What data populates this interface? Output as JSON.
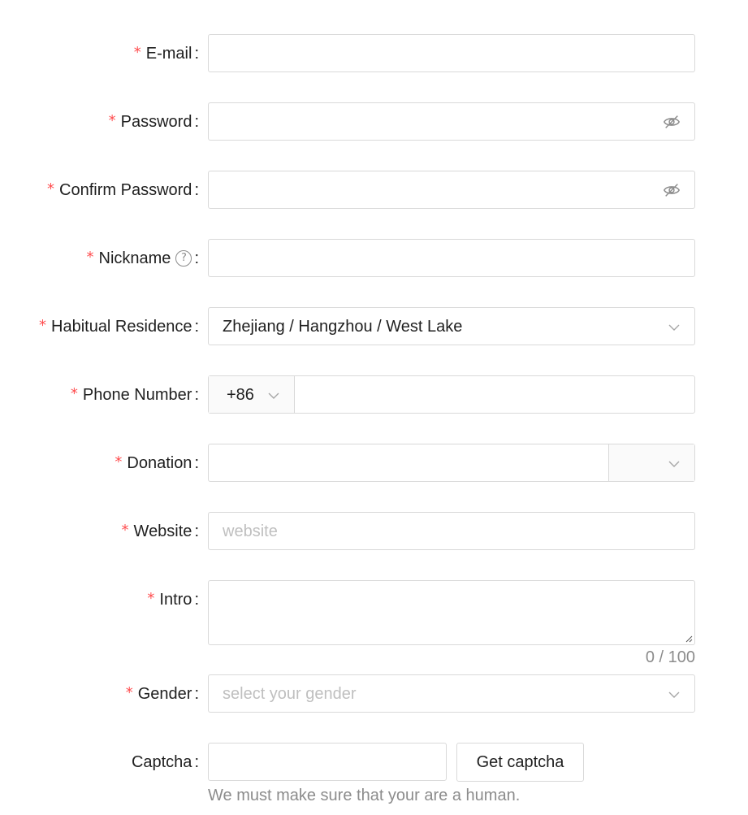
{
  "form": {
    "email": {
      "label": "E-mail",
      "value": ""
    },
    "password": {
      "label": "Password",
      "value": "",
      "visibility_icon": "eye-invisible-icon"
    },
    "confirm_password": {
      "label": "Confirm Password",
      "value": "",
      "visibility_icon": "eye-invisible-icon"
    },
    "nickname": {
      "label": "Nickname",
      "help_icon": "question-circle-icon",
      "help_glyph": "?",
      "value": ""
    },
    "residence": {
      "label": "Habitual Residence",
      "value": "Zhejiang / Hangzhou / West Lake"
    },
    "phone": {
      "label": "Phone Number",
      "prefix": "+86",
      "value": ""
    },
    "donation": {
      "label": "Donation",
      "value": "",
      "suffix": ""
    },
    "website": {
      "label": "Website",
      "placeholder": "website",
      "value": ""
    },
    "intro": {
      "label": "Intro",
      "value": "",
      "counter": "0 / 100"
    },
    "gender": {
      "label": "Gender",
      "placeholder": "select your gender"
    },
    "captcha": {
      "label": "Captcha",
      "value": "",
      "button_label": "Get captcha",
      "extra": "We must make sure that your are a human."
    },
    "required_mark": "*",
    "colon": ":"
  },
  "colors": {
    "required": "#ff4d4f",
    "border": "#d9d9d9",
    "placeholder": "#bfbfbf",
    "hint": "#8c8c8c"
  }
}
